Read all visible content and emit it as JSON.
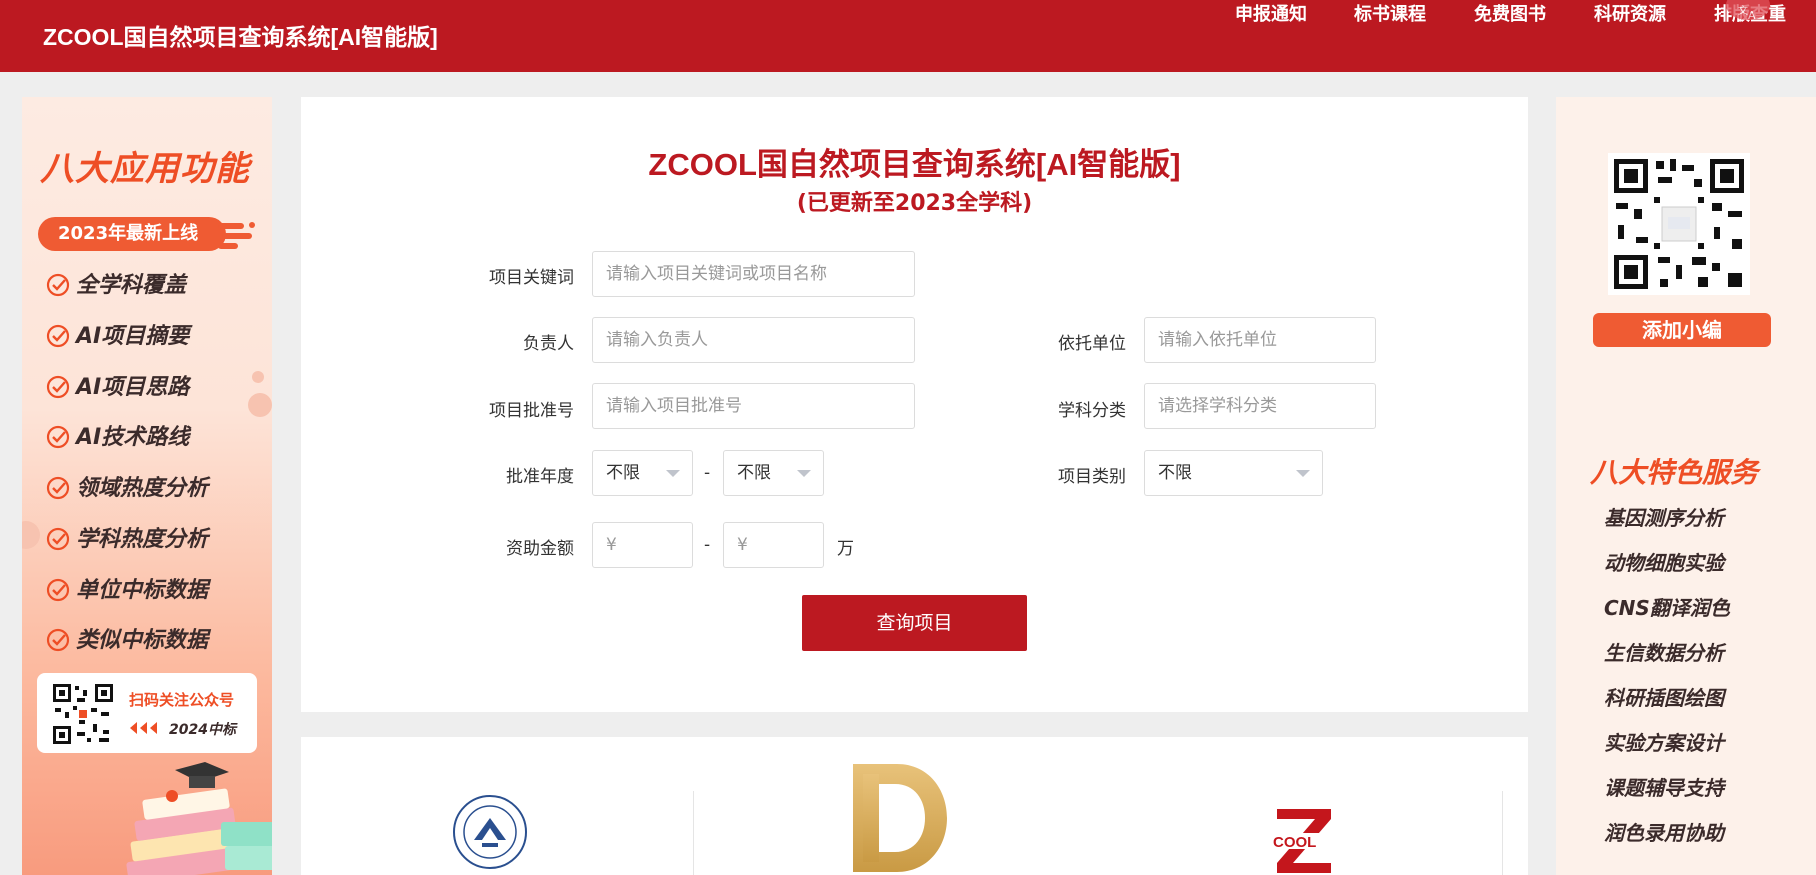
{
  "header": {
    "brand": "ZCOOL国自然项目查询系统[AI智能版]",
    "nav": [
      "申报通知",
      "标书课程",
      "免费图书",
      "科研资源",
      "排版查重"
    ],
    "translate_icon": "translate-icon"
  },
  "left_banner": {
    "title": "八大应用功能",
    "badge": "2023年最新上线",
    "features": [
      "全学科覆盖",
      "AI项目摘要",
      "AI项目思路",
      "AI技术路线",
      "领域热度分析",
      "学科热度分析",
      "单位中标数据",
      "类似中标数据"
    ],
    "qr_text": "扫码关注公众号",
    "qr_subtext": "2024中标"
  },
  "main": {
    "title": "ZCOOL国自然项目查询系统[AI智能版]",
    "subtitle": "(已更新至2023全学科)",
    "fields": {
      "keyword": {
        "label": "项目关键词",
        "placeholder": "请输入项目关键词或项目名称"
      },
      "leader": {
        "label": "负责人",
        "placeholder": "请输入负责人"
      },
      "institution": {
        "label": "依托单位",
        "placeholder": "请输入依托单位"
      },
      "approval_no": {
        "label": "项目批准号",
        "placeholder": "请输入项目批准号"
      },
      "discipline": {
        "label": "学科分类",
        "placeholder": "请选择学科分类"
      },
      "year": {
        "label": "批准年度",
        "from": "不限",
        "to": "不限",
        "separator": "-"
      },
      "category": {
        "label": "项目类别",
        "value": "不限"
      },
      "funding": {
        "label": "资助金额",
        "from_symbol": "¥",
        "to_symbol": "¥",
        "separator": "-",
        "unit": "万"
      }
    },
    "search_button": "查询项目"
  },
  "logos": [
    "university-seal-logo",
    "gold-d-logo",
    "zcool-logo"
  ],
  "right_banner": {
    "add_button": "添加小编",
    "title": "八大特色服务",
    "services": [
      "基因测序分析",
      "动物细胞实验",
      "CNS翻译润色",
      "生信数据分析",
      "科研插图绘图",
      "实验方案设计",
      "课题辅导支持",
      "润色录用协助"
    ]
  },
  "colors": {
    "brand_red": "#bc1921",
    "accent_orange": "#ef5b33"
  }
}
